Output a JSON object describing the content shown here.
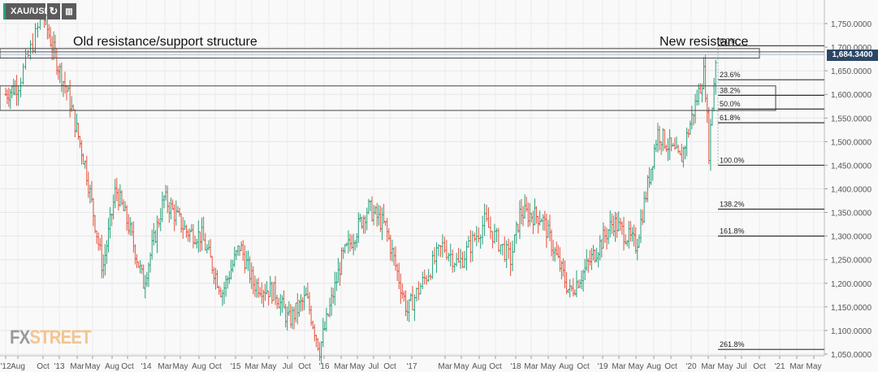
{
  "toolbar": {
    "symbol": "XAU/USD",
    "refresh_icon": "refresh-icon",
    "calendar_icon": "calendar-icon"
  },
  "annotations": {
    "left": "Old resistance/support structure",
    "right": "New resistance"
  },
  "logo": {
    "fx": "FX",
    "street": "STREET"
  },
  "price_tag": "1,684.3400",
  "colors": {
    "up": "#26a17b",
    "down": "#e5533d",
    "tag": "#2c4766"
  },
  "chart_data": {
    "type": "ohlc",
    "title": "XAU/USD weekly",
    "ylim": [
      1050,
      1750
    ],
    "y_ticks": [
      "1,750.0000",
      "1,700.0000",
      "1,650.0000",
      "1,600.0000",
      "1,550.0000",
      "1,500.0000",
      "1,450.0000",
      "1,400.0000",
      "1,350.0000",
      "1,300.0000",
      "1,250.0000",
      "1,200.0000",
      "1,150.0000",
      "1,100.0000",
      "1,050.0000"
    ],
    "x_ticks": [
      "'12",
      "Aug",
      "Oct",
      "'13",
      "Mar",
      "May",
      "Aug",
      "Oct",
      "'14",
      "Mar",
      "May",
      "Aug",
      "Oct",
      "'15",
      "Mar",
      "May",
      "Jul",
      "Oct",
      "'16",
      "Mar",
      "May",
      "Jul",
      "Oct",
      "'17",
      "Mar",
      "May",
      "Aug",
      "Oct",
      "'18",
      "Mar",
      "May",
      "Aug",
      "Oct",
      "'19",
      "Mar",
      "May",
      "Aug",
      "Oct",
      "'20",
      "Mar",
      "May",
      "Jul",
      "Oct",
      "'21",
      "Mar",
      "May"
    ],
    "price_path": [
      [
        2012.45,
        1600
      ],
      [
        2012.6,
        1620
      ],
      [
        2012.8,
        1770
      ],
      [
        2012.95,
        1680
      ],
      [
        2013.1,
        1600
      ],
      [
        2013.3,
        1450
      ],
      [
        2013.5,
        1230
      ],
      [
        2013.65,
        1400
      ],
      [
        2013.8,
        1320
      ],
      [
        2013.97,
        1200
      ],
      [
        2014.2,
        1380
      ],
      [
        2014.45,
        1310
      ],
      [
        2014.62,
        1300
      ],
      [
        2014.85,
        1180
      ],
      [
        2015.05,
        1280
      ],
      [
        2015.2,
        1200
      ],
      [
        2015.45,
        1180
      ],
      [
        2015.6,
        1120
      ],
      [
        2015.8,
        1170
      ],
      [
        2015.95,
        1060
      ],
      [
        2016.2,
        1250
      ],
      [
        2016.5,
        1360
      ],
      [
        2016.7,
        1320
      ],
      [
        2016.95,
        1140
      ],
      [
        2017.3,
        1280
      ],
      [
        2017.45,
        1240
      ],
      [
        2017.7,
        1330
      ],
      [
        2017.95,
        1250
      ],
      [
        2018.05,
        1350
      ],
      [
        2018.3,
        1340
      ],
      [
        2018.62,
        1180
      ],
      [
        2018.8,
        1230
      ],
      [
        2019.12,
        1330
      ],
      [
        2019.38,
        1280
      ],
      [
        2019.62,
        1520
      ],
      [
        2019.88,
        1460
      ],
      [
        2020.02,
        1560
      ],
      [
        2020.15,
        1650
      ],
      [
        2020.2,
        1480
      ],
      [
        2020.28,
        1684
      ]
    ],
    "last_price": 1684.34,
    "fibonacci": [
      {
        "label": "0.0%",
        "value": 1703
      },
      {
        "label": "23.6%",
        "value": 1631
      },
      {
        "label": "38.2%",
        "value": 1598
      },
      {
        "label": "50.0%",
        "value": 1569
      },
      {
        "label": "61.8%",
        "value": 1540
      },
      {
        "label": "100.0%",
        "value": 1450
      },
      {
        "label": "138.2%",
        "value": 1357
      },
      {
        "label": "161.8%",
        "value": 1300
      },
      {
        "label": "261.8%",
        "value": 1060
      }
    ],
    "zones": [
      {
        "name": "old-resistance-top",
        "from": 1677,
        "to": 1697
      },
      {
        "name": "old-resistance-lower",
        "from": 1566,
        "to": 1618
      }
    ]
  }
}
